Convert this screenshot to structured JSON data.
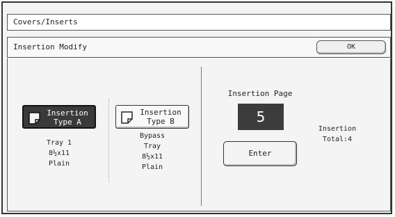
{
  "header": {
    "title": "Covers/Inserts"
  },
  "subheader": {
    "title": "Insertion Modify",
    "ok_label": "OK"
  },
  "type_a": {
    "label_line1": "Insertion",
    "label_line2": "Type A",
    "tray": "Tray 1",
    "size": "8½x11",
    "paper": "Plain",
    "selected": true
  },
  "type_b": {
    "label_line1": "Insertion",
    "label_line2": "Type B",
    "tray_line1": "Bypass",
    "tray_line2": "Tray",
    "size": "8½x11",
    "paper": "Plain",
    "selected": false
  },
  "insertion_page": {
    "label": "Insertion Page",
    "value": "5",
    "enter_label": "Enter"
  },
  "total": {
    "line1": "Insertion",
    "line2": "Total:4"
  },
  "colors": {
    "selected_bg": "#3a3a3a",
    "display_bg": "#3c3c3c",
    "panel_bg": "#f4f4f4"
  },
  "icons": {
    "page_icon": "folded-page-icon"
  }
}
